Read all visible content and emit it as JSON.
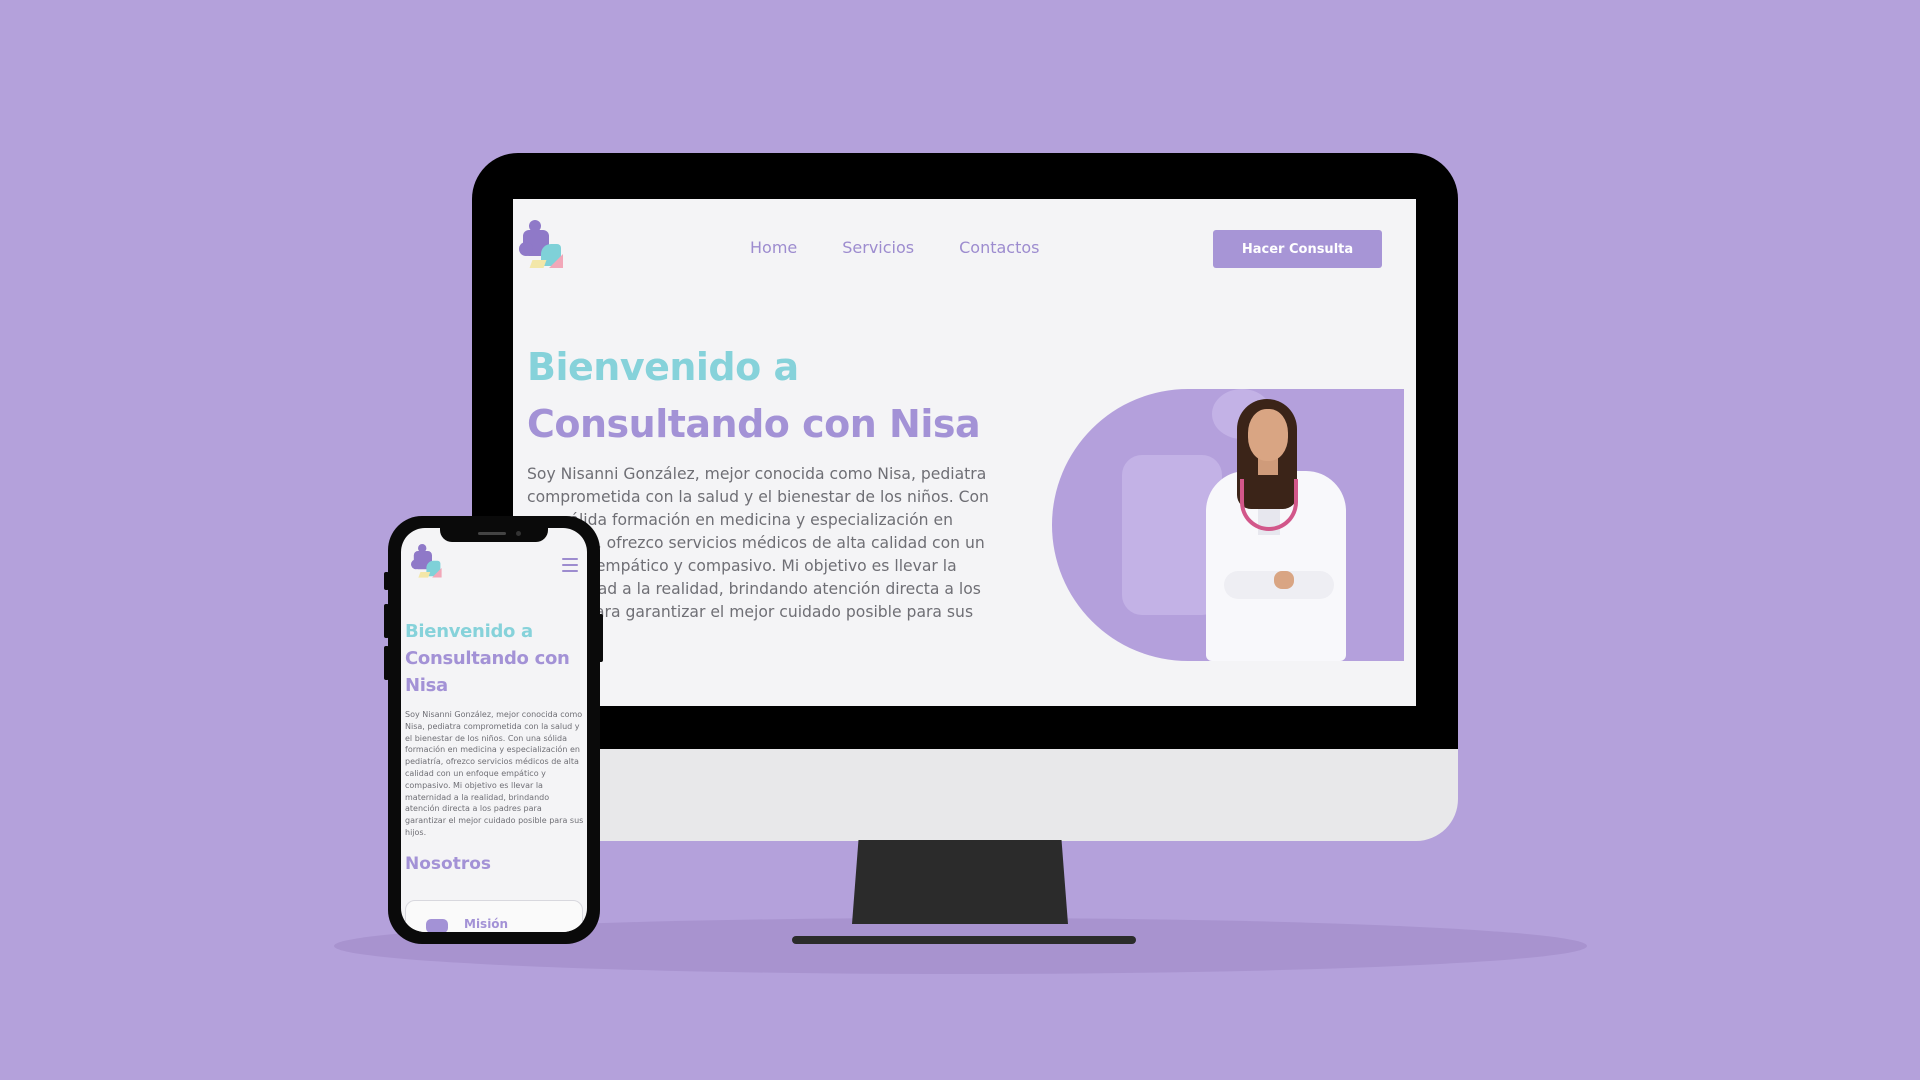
{
  "desktop": {
    "logo": "consultando-con-nisa-logo",
    "nav": [
      "Home",
      "Servicios",
      "Contactos"
    ],
    "cta_label": "Hacer Consulta",
    "hero": {
      "title_line1": "Bienvenido a",
      "title_line2": "Consultando con Nisa",
      "text": "Soy Nisanni González, mejor conocida como Nisa, pediatra comprometida con la salud y el bienestar de los niños. Con una sólida formación en medicina y especialización en pediatría, ofrezco servicios médicos de alta calidad con un enfoque empático y compasivo. Mi objetivo es llevar la maternidad a la realidad, brindando atención directa a los padres para garantizar el mejor cuidado posible para sus hijos."
    },
    "image": "doctor-portrait-with-stethoscope"
  },
  "mobile": {
    "logo": "consultando-con-nisa-logo",
    "menu_icon": "hamburger-menu-icon",
    "hero": {
      "title_line1": "Bienvenido a",
      "title_line2": "Consultando con Nisa",
      "text": "Soy Nisanni González, mejor conocida como Nisa, pediatra comprometida con la salud y el bienestar de los niños. Con una sólida formación en medicina y especialización en pediatría, ofrezco servicios médicos de alta calidad con un enfoque empático y compasivo. Mi objetivo es llevar la maternidad a la realidad, brindando atención directa a los padres para garantizar el mejor cuidado posible para sus hijos."
    },
    "section_title": "Nosotros",
    "card_label": "Misión"
  },
  "colors": {
    "background": "#b4a1db",
    "accent_purple": "#a392d6",
    "accent_teal": "#86d2da",
    "cta": "#a795d6"
  }
}
